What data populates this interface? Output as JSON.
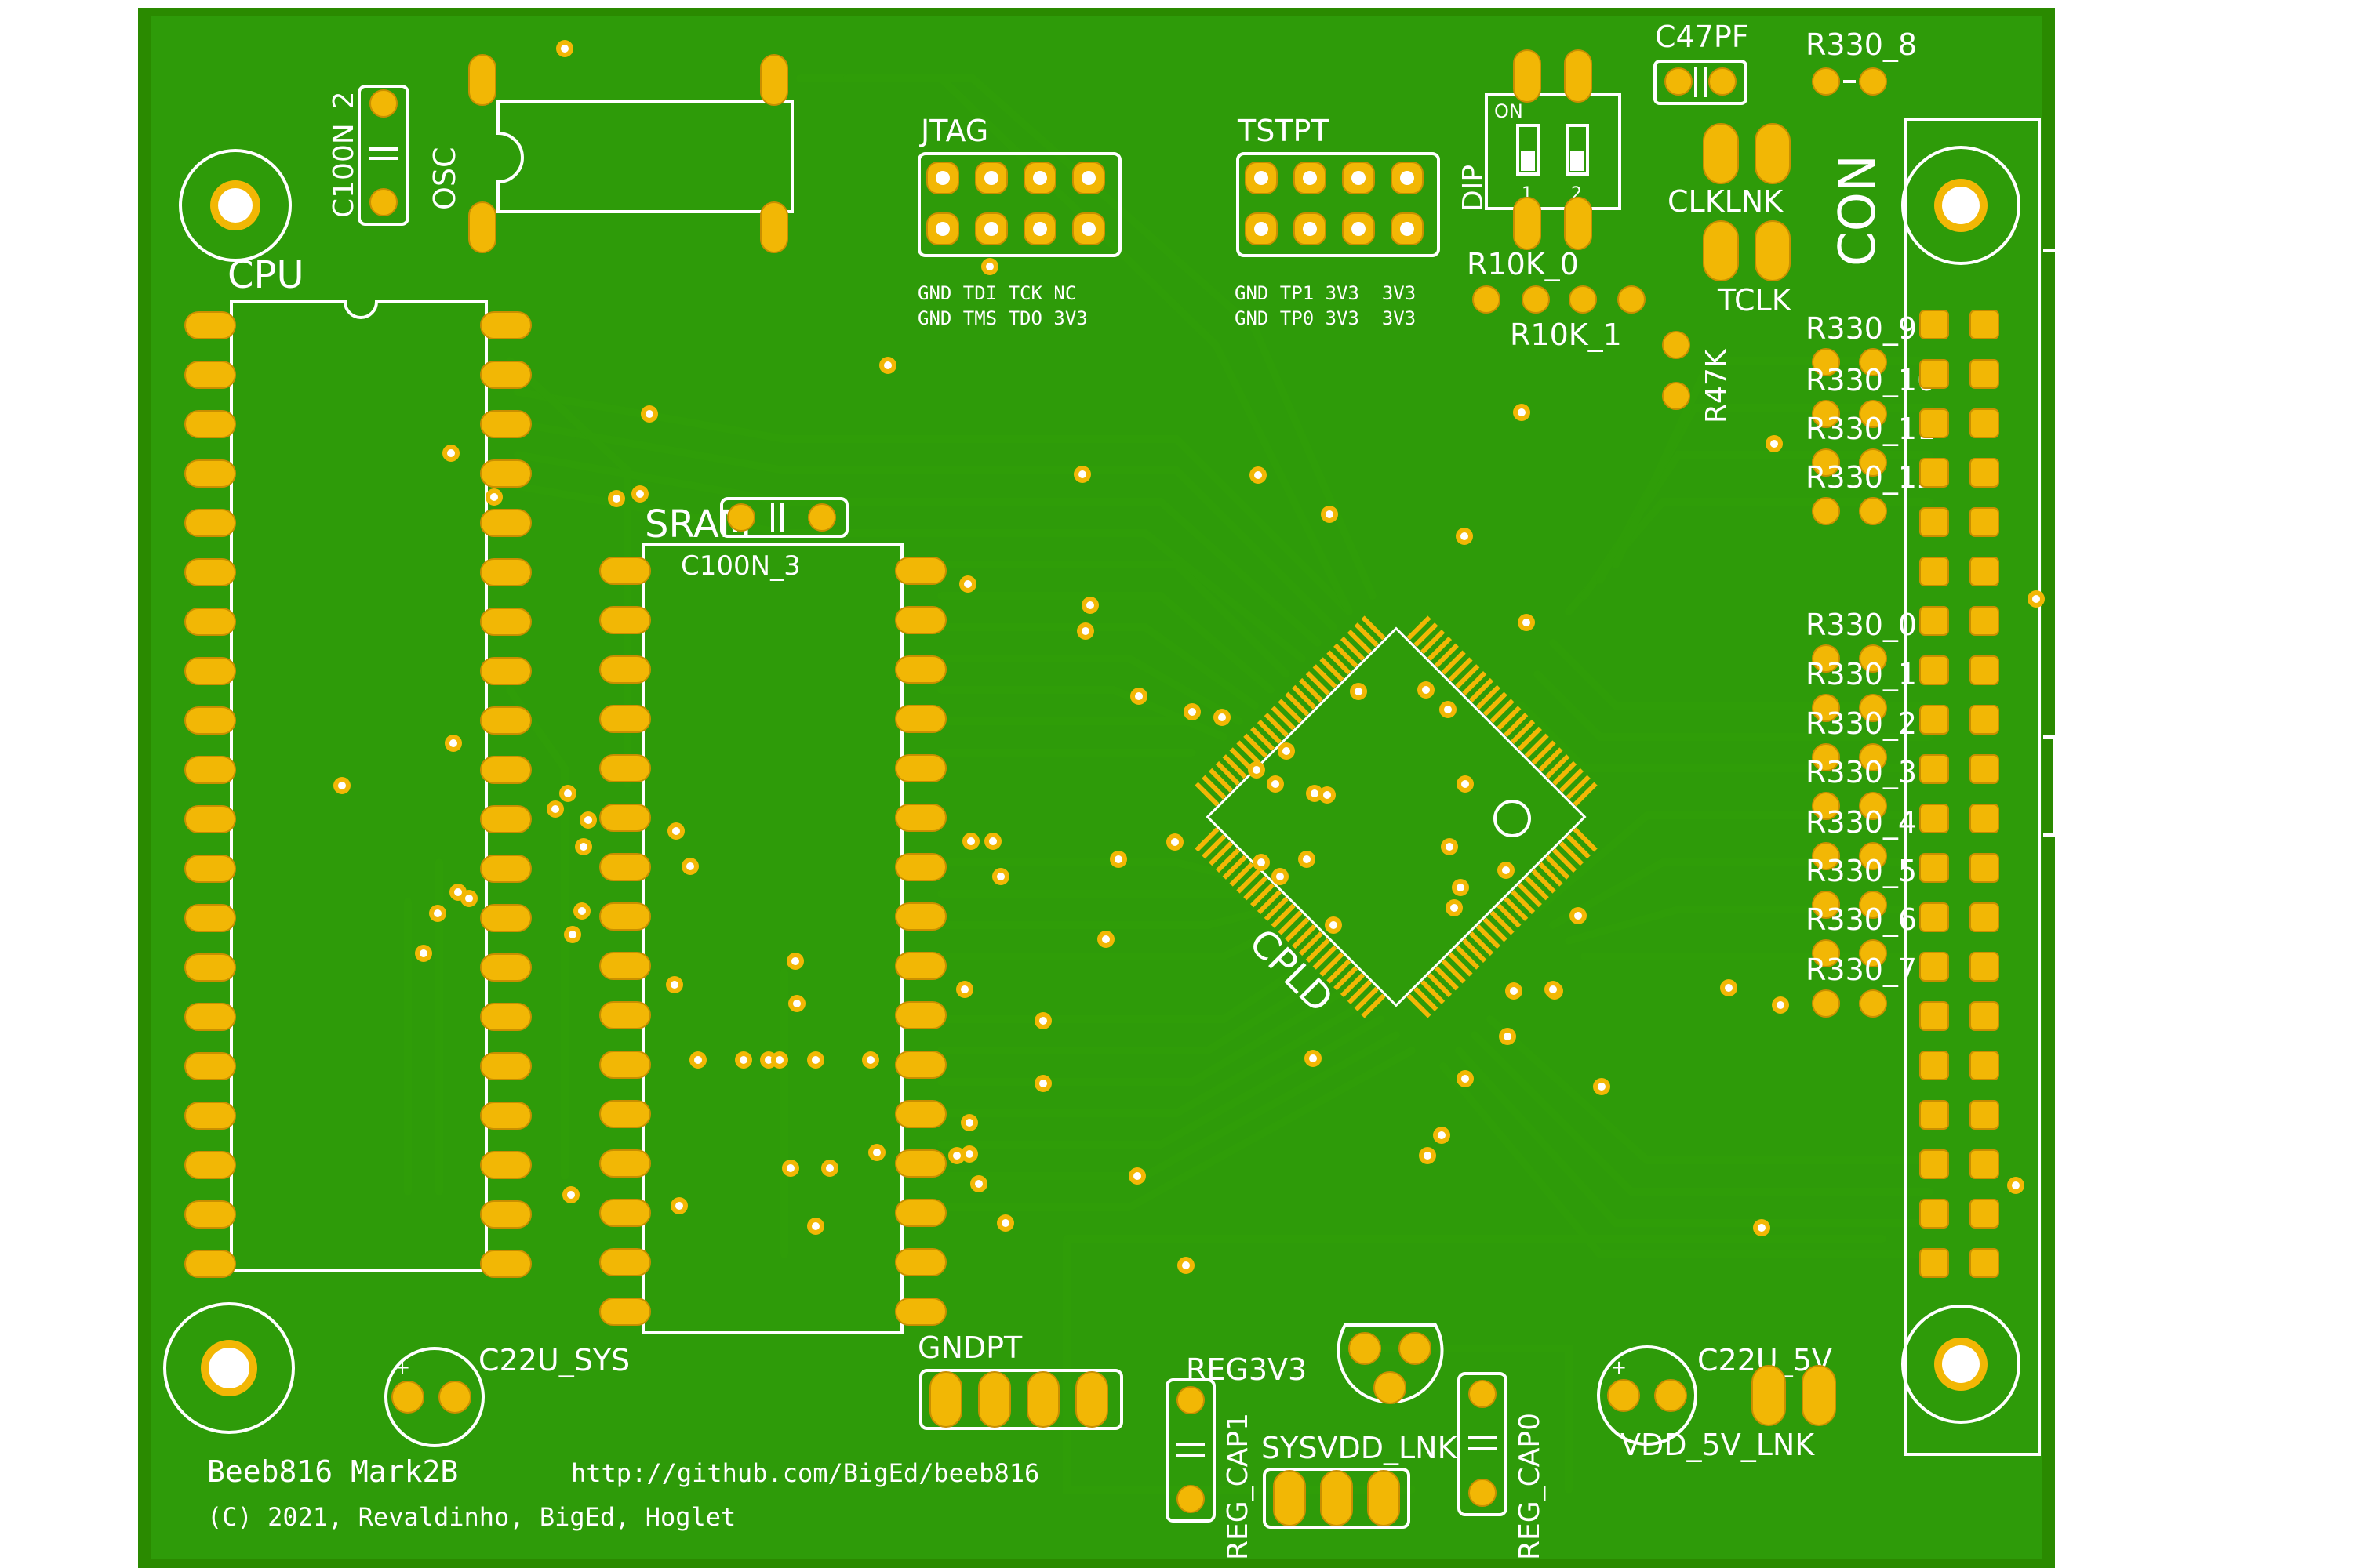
{
  "board": {
    "title": "Beeb816 Mark2B",
    "url": "http://github.com/BigEd/beeb816",
    "copyright": "(C) 2021, Revaldinho, BigEd, Hoglet",
    "colors": {
      "board": "#2a8a00",
      "copper": "#2e9b09",
      "pad": "#f2b705",
      "silk": "#ffffff"
    }
  },
  "components": {
    "cpu": "CPU",
    "sram": "SRAM",
    "cpld": "CPLD",
    "osc": "OSC",
    "c100n_2": "C100N_2",
    "c100n_3": "C100N_3",
    "jtag": "JTAG",
    "tstpt": "TSTPT",
    "dip": "DIP",
    "dip_on": "ON",
    "dip_1": "1",
    "dip_2": "2",
    "c47pf": "C47PF",
    "r330_8": "R330_8",
    "clklnk": "CLKLNK",
    "tclk": "TCLK",
    "con": "CON",
    "r10k_0": "R10K_0",
    "r10k_1": "R10K_1",
    "r47k": "R47K",
    "r330_9": "R330_9",
    "r330_10": "R330_10",
    "r330_11": "R330_11",
    "r330_12": "R330_12",
    "r330_0": "R330_0",
    "r330_1": "R330_1",
    "r330_2": "R330_2",
    "r330_3": "R330_3",
    "r330_4": "R330_4",
    "r330_5": "R330_5",
    "r330_6": "R330_6",
    "r330_7": "R330_7",
    "c22u_sys": "C22U_SYS",
    "gndpt": "GNDPT",
    "reg3v3": "REG3V3",
    "reg_cap1": "REG_CAP1",
    "reg_cap0": "REG_CAP0",
    "sysvdd_lnk": "SYSVDD_LNK",
    "c22u_5v": "C22U_5V",
    "vdd_5v_lnk": "VDD_5V_LNK"
  },
  "jtag_pins": {
    "row1": "GND TDI TCK NC",
    "row2": "GND TMS TDO 3V3"
  },
  "tstpt_pins": {
    "row1": "GND TP1 3V3  3V3",
    "row2": "GND TP0 3V3  3V3"
  }
}
